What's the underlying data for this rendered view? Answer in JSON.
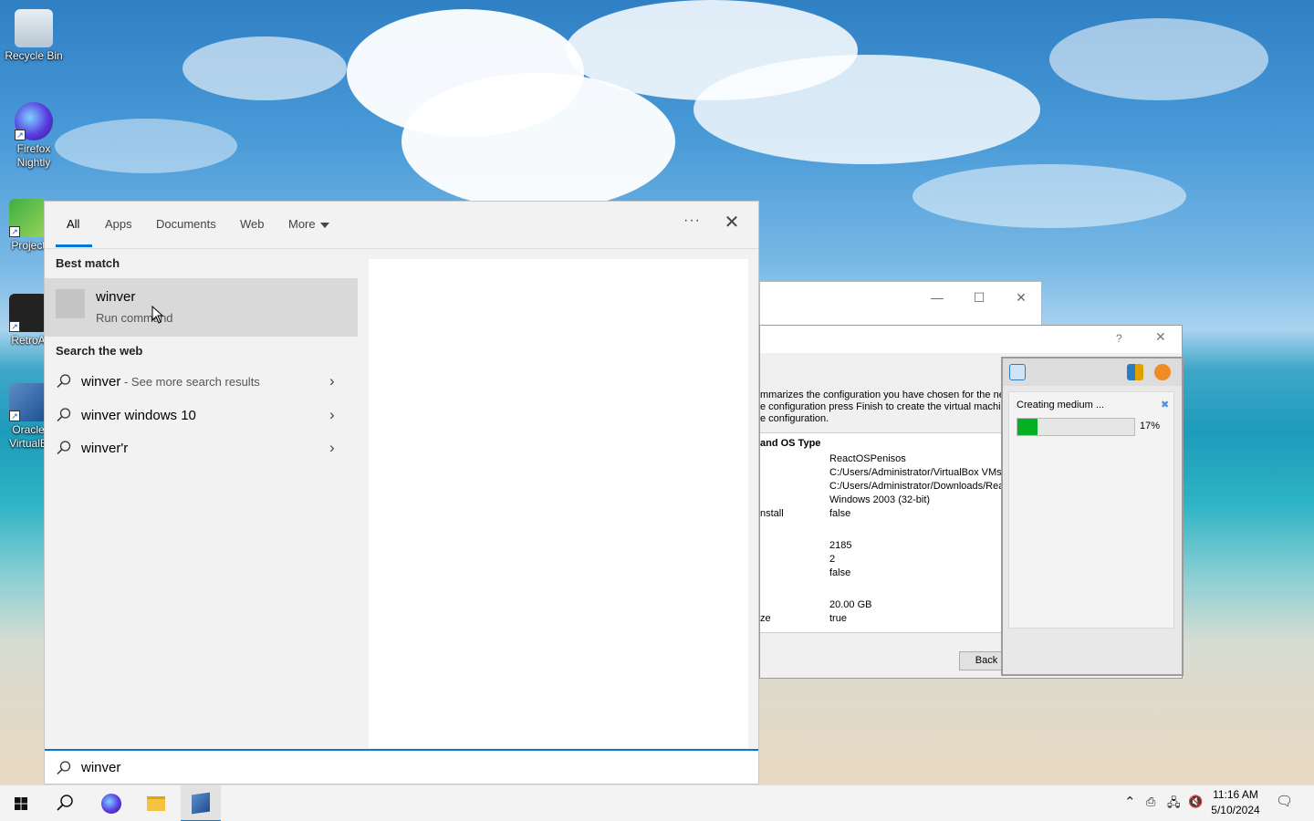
{
  "desktop": {
    "icons": [
      {
        "label": "Recycle Bin",
        "icon": "recycle-bin-icon"
      },
      {
        "label": "Firefox Nightly",
        "icon": "firefox-nightly-icon"
      },
      {
        "label": "Project",
        "icon": "project-icon"
      },
      {
        "label": "RetroA",
        "icon": "retroarch-icon"
      },
      {
        "label": "Oracle VirtualB",
        "icon": "virtualbox-icon"
      }
    ]
  },
  "search_menu": {
    "tabs": [
      {
        "label": "All",
        "active": true
      },
      {
        "label": "Apps"
      },
      {
        "label": "Documents"
      },
      {
        "label": "Web"
      },
      {
        "label": "More"
      }
    ],
    "more_label": "···",
    "close_label": "✕",
    "best_match_heading": "Best match",
    "best_match": {
      "title": "winver",
      "subtitle": "Run command"
    },
    "web_heading": "Search the web",
    "web_results": [
      {
        "query": "winver",
        "hint": " - See more search results"
      },
      {
        "query": "winver windows 10",
        "hint": ""
      },
      {
        "query": "winver'r",
        "hint": ""
      }
    ],
    "search_value": "winver"
  },
  "wizard": {
    "help_label": "?",
    "close_label": "✕",
    "summary_lines": [
      "mmarizes the configuration you have chosen for the nev",
      "e configuration press Finish to create the virtual machin",
      "e configuration."
    ],
    "section_label": "and OS Type",
    "rows": [
      {
        "key": "",
        "value": "ReactOSPenisos"
      },
      {
        "key": "",
        "value": "C:/Users/Administrator/VirtualBox VMs/"
      },
      {
        "key": "",
        "value": "C:/Users/Administrator/Downloads/Rea"
      },
      {
        "key": "",
        "value": "Windows 2003 (32-bit)"
      },
      {
        "key": "nstall",
        "value": "false"
      },
      {
        "key": "",
        "value": "2185"
      },
      {
        "key": "",
        "value": "2"
      },
      {
        "key": "",
        "value": "false"
      },
      {
        "key": "",
        "value": "20.00 GB"
      },
      {
        "key": "ze",
        "value": "true"
      }
    ],
    "back_button": "Back"
  },
  "progress": {
    "label": "Creating medium ...",
    "percent_text": "17%",
    "fraction": 0.17
  },
  "taskbar": {
    "time": "11:16 AM",
    "date": "5/10/2024"
  },
  "colors": {
    "accent": "#0078d7",
    "progress_fill": "#06b025"
  }
}
